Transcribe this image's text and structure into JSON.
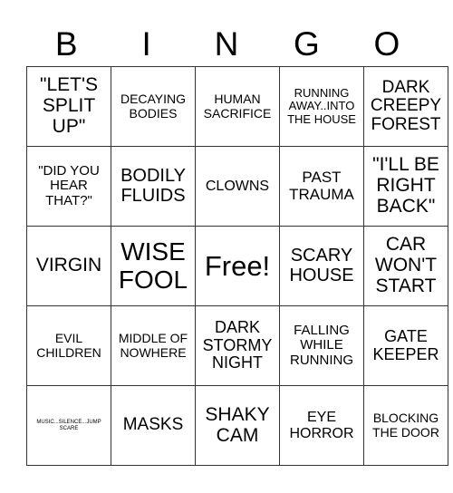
{
  "header": [
    "B",
    "I",
    "N",
    "G",
    "O"
  ],
  "cells": [
    [
      "\"LET'S SPLIT UP\"",
      "DECAYING BODIES",
      "HUMAN SACRIFICE",
      "RUNNING AWAY..INTO THE HOUSE",
      "DARK CREEPY FOREST"
    ],
    [
      "\"DID YOU HEAR THAT?\"",
      "BODILY FLUIDS",
      "CLOWNS",
      "PAST TRAUMA",
      "\"I'LL BE RIGHT BACK\""
    ],
    [
      "VIRGIN",
      "WISE FOOL",
      "Free!",
      "SCARY HOUSE",
      "CAR WON'T START"
    ],
    [
      "EVIL CHILDREN",
      "MIDDLE OF NOWHERE",
      "DARK STORMY NIGHT",
      "FALLING WHILE RUNNING",
      "GATE KEEPER"
    ],
    [
      "MUSIC...SILENCE...JUMP SCARE",
      "MASKS",
      "SHAKY CAM",
      "EYE HORROR",
      "BLOCKING THE DOOR"
    ]
  ]
}
